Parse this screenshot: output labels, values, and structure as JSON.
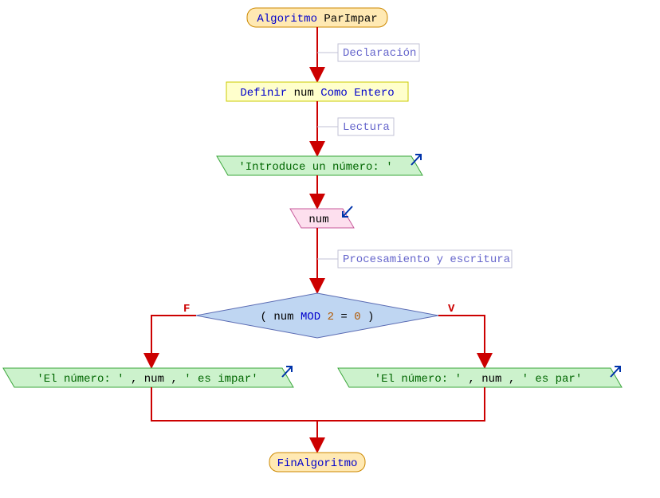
{
  "nodes": {
    "start": {
      "kw": "Algoritmo",
      "name": "ParImpar"
    },
    "end": {
      "kw": "FinAlgoritmo"
    },
    "declare": {
      "kw1": "Definir",
      "var": "num",
      "kw2": "Como",
      "type": "Entero"
    },
    "prompt": {
      "str": "'Introduce un número: '"
    },
    "read": {
      "var": "num"
    },
    "cond": {
      "lpar": "(",
      "var": "num",
      "op": "MOD",
      "two": "2",
      "eq": "=",
      "zero": "0",
      "rpar": ")"
    },
    "out_false": {
      "s1": "'El número: '",
      "c1": ",",
      "var": "num",
      "c2": ",",
      "s2": "' es impar'"
    },
    "out_true": {
      "s1": "'El número: '",
      "c1": ",",
      "var": "num",
      "c2": ",",
      "s2": "' es par'"
    }
  },
  "labels": {
    "decl": "Declaración",
    "lect": "Lectura",
    "proc": "Procesamiento y escritura",
    "false": "F",
    "true": "V"
  }
}
